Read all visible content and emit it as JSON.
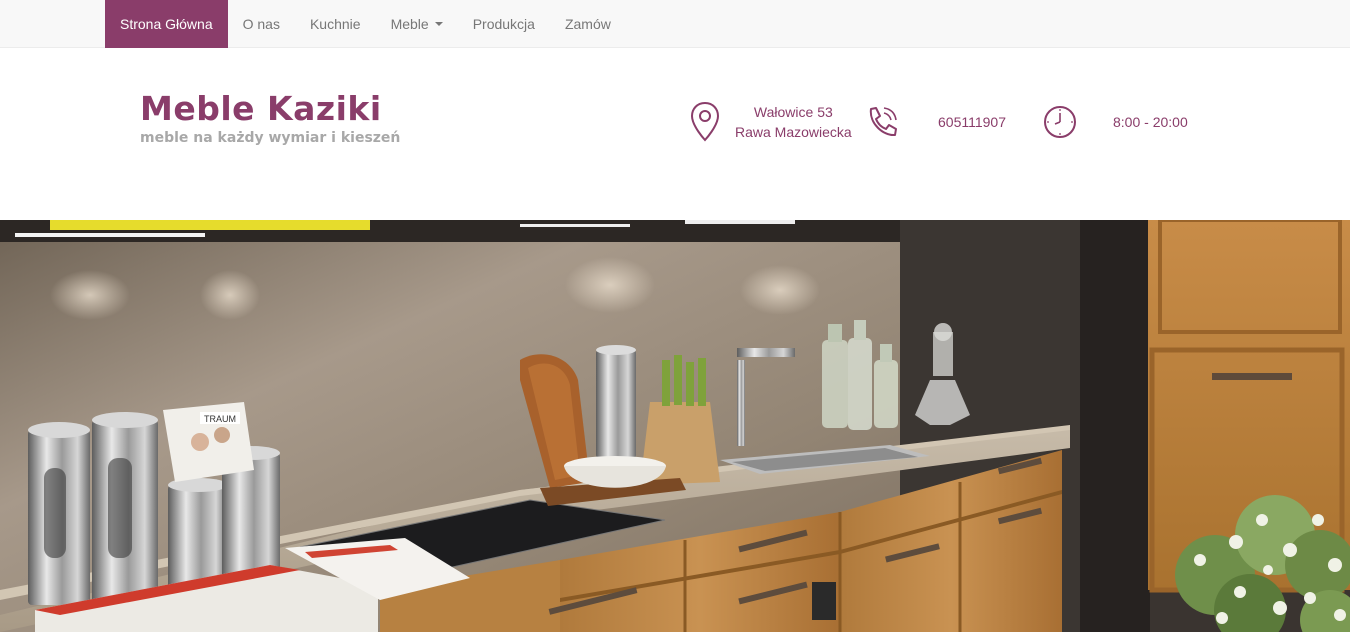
{
  "nav": {
    "items": [
      {
        "label": "Strona Główna",
        "active": true
      },
      {
        "label": "O nas"
      },
      {
        "label": "Kuchnie"
      },
      {
        "label": "Meble",
        "dropdown": true
      },
      {
        "label": "Produkcja"
      },
      {
        "label": "Zamów"
      }
    ]
  },
  "brand": {
    "title": "Meble Kaziki",
    "tagline": "meble na każdy wymiar i kieszeń"
  },
  "contact": {
    "address_line1": "Wałowice 53",
    "address_line2": "Rawa Mazowiecka",
    "phone": "605111907",
    "hours": "8:00 - 20:00"
  },
  "hero": {
    "image_label": "kitchen-photo",
    "catalog_brand": "TRAUM"
  },
  "colors": {
    "accent": "#8a3d6a",
    "navbar_bg": "#f8f8f8",
    "tagline": "#a8a8a8"
  }
}
